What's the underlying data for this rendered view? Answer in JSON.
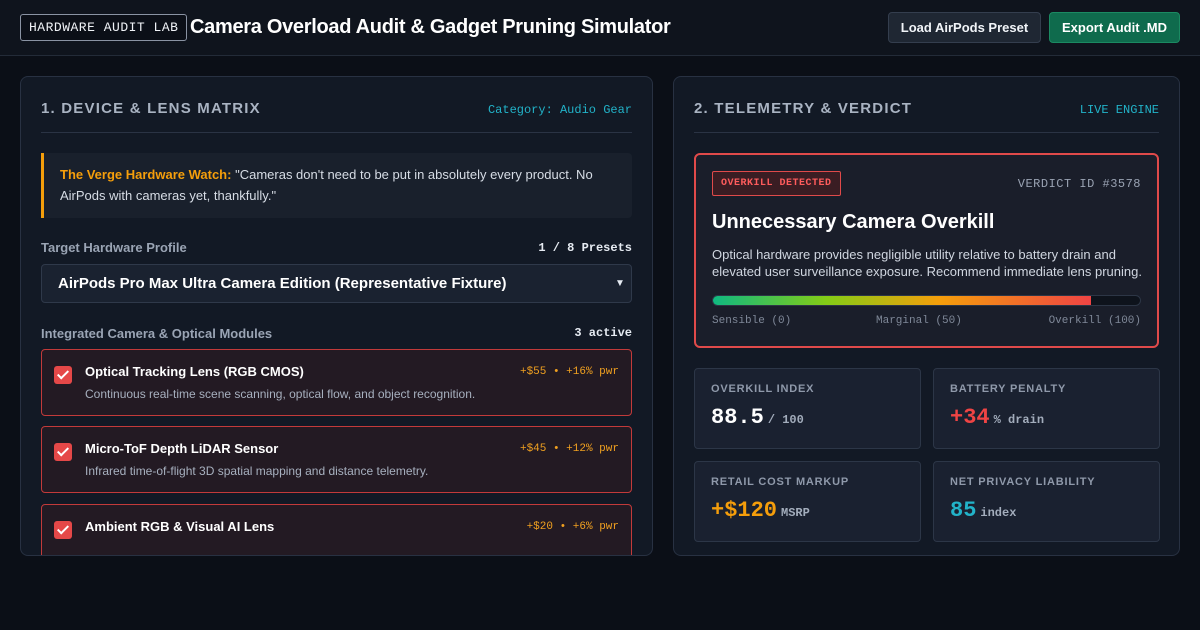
{
  "header": {
    "brand_badge": "HARDWARE AUDIT LAB",
    "title": "Camera Overload Audit & Gadget Pruning Simulator",
    "preset_button": "Load AirPods Preset",
    "export_button": "Export Audit .MD"
  },
  "left_panel": {
    "title": "1. DEVICE & LENS MATRIX",
    "category": "Category: Audio Gear",
    "quote_source": "The Verge Hardware Watch:",
    "quote_text": "\"Cameras don't need to be put in absolutely every product. No AirPods with cameras yet, thankfully.\"",
    "target_label": "Target Hardware Profile",
    "preset_count": "1 / 8 Presets",
    "selected_profile": "AirPods Pro Max Ultra Camera Edition (Representative Fixture)",
    "modules_label": "Integrated Camera & Optical Modules",
    "modules_active": "3 active",
    "modules": [
      {
        "name": "Optical Tracking Lens (RGB CMOS)",
        "cost": "+$55 • +16% pwr",
        "desc": "Continuous real-time scene scanning, optical flow, and object recognition.",
        "checked": true
      },
      {
        "name": "Micro-ToF Depth LiDAR Sensor",
        "cost": "+$45 • +12% pwr",
        "desc": "Infrared time-of-flight 3D spatial mapping and distance telemetry.",
        "checked": true
      },
      {
        "name": "Ambient RGB & Visual AI Lens",
        "cost": "+$20 • +6% pwr",
        "desc": "",
        "checked": true
      }
    ]
  },
  "right_panel": {
    "title": "2. TELEMETRY & VERDICT",
    "status": "LIVE ENGINE",
    "verdict": {
      "badge": "OVERKILL DETECTED",
      "id": "VERDICT ID #3578",
      "title": "Unnecessary Camera Overkill",
      "description": "Optical hardware provides negligible utility relative to battery drain and elevated user surveillance exposure. Recommend immediate lens pruning.",
      "gauge_value": 88.5,
      "gauge_max": 100,
      "gauge_labels": [
        "Sensible (0)",
        "Marginal (50)",
        "Overkill (100)"
      ]
    },
    "stats": [
      {
        "label": "OVERKILL INDEX",
        "value": "88.5",
        "unit": "/ 100",
        "color": "#ffffff"
      },
      {
        "label": "BATTERY PENALTY",
        "value": "+34",
        "unit": "% drain",
        "color": "#ef4444"
      },
      {
        "label": "RETAIL COST MARKUP",
        "value": "+$120",
        "unit": "MSRP",
        "color": "#f59e0b"
      },
      {
        "label": "NET PRIVACY LIABILITY",
        "value": "85",
        "unit": "index",
        "color": "#22b3c9"
      }
    ]
  },
  "colors": {
    "accent_cyan": "#22b3c9",
    "accent_amber": "#f59e0b",
    "alert_red": "#ef4444",
    "export_green": "#0f6b4d"
  }
}
